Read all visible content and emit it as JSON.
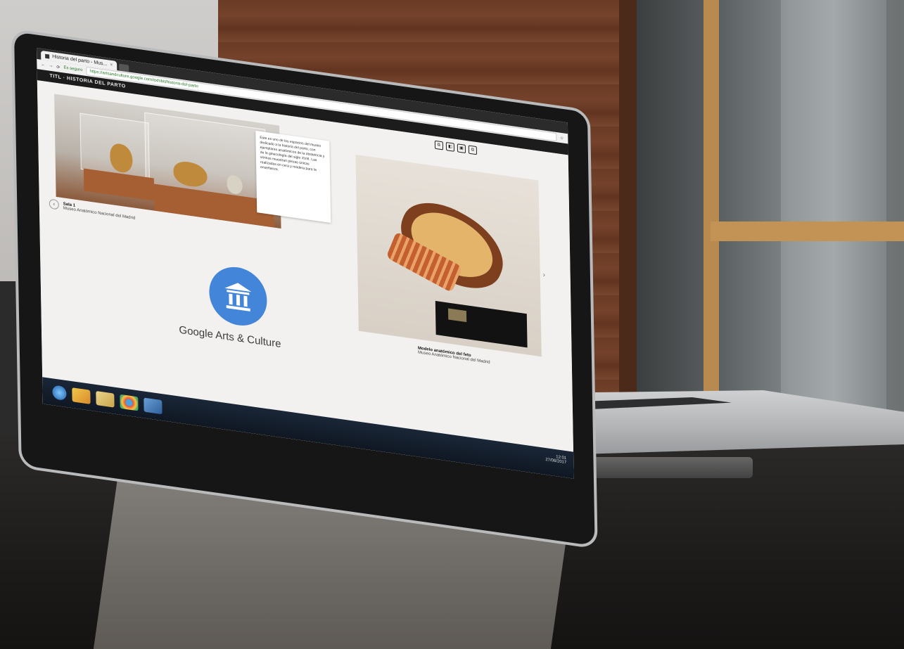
{
  "browser": {
    "tab_title": "Historia del parto - Mus...",
    "tab_close": "×",
    "secure_label": "Es seguro",
    "url": "https://artsandculture.google.com/exhibit/historia-del-parto"
  },
  "app": {
    "header_title": "TITL · HISTORIA DEL PARTO",
    "controls": [
      "⧉",
      "◧",
      "▣",
      "⧉"
    ]
  },
  "exhibit": {
    "photo1_caption_title": "Sala 1",
    "photo1_caption_sub": "Museo Anatómico Nacional del Madrid",
    "text_card": "Este es uno de los espacios del museo dedicado a la historia del parto, con ejemplares anatómicos de la obstetricia y de la ginecología del siglo XVIII. Las vitrinas muestran piezas únicas realizadas en cera y madera para la enseñanza.",
    "logo_text": "Google Arts & Culture",
    "photo2_caption_title": "Modelo anatómico del feto",
    "photo2_caption_sub": "Museo Anatómico Nacional del Madrid",
    "nav_prev": "‹",
    "nav_next": "›"
  },
  "taskbar": {
    "clock_time": "12:01",
    "clock_date": "27/08/2017"
  },
  "colors": {
    "logo_blue": "#4285d9",
    "header_bar": "#1c1c1c",
    "page_bg": "#f2f1ef"
  }
}
